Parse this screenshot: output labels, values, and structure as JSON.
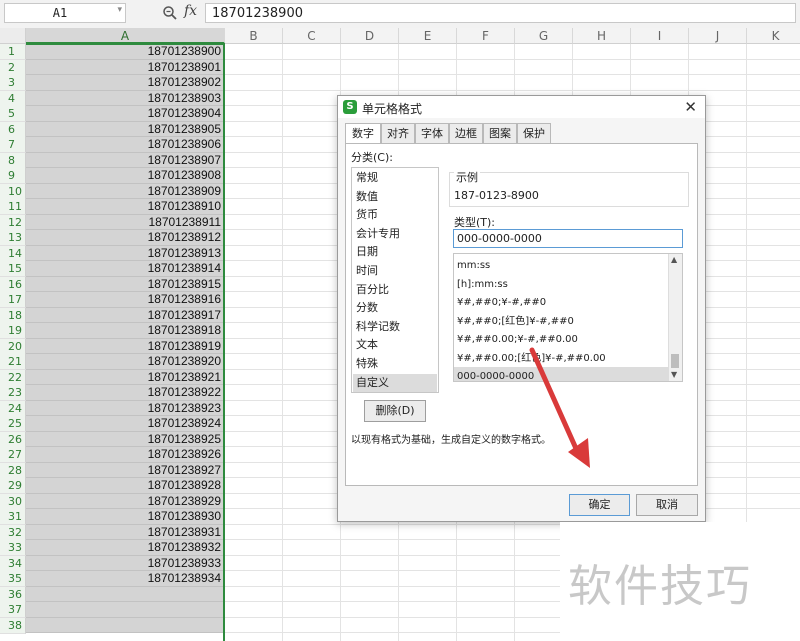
{
  "formula_bar": {
    "name_box": "A1",
    "fx_label": "fx",
    "formula": "18701238900"
  },
  "columns": [
    "A",
    "B",
    "C",
    "D",
    "E",
    "F",
    "G",
    "H",
    "I",
    "J",
    "K"
  ],
  "rows": [
    "1",
    "2",
    "3",
    "4",
    "5",
    "6",
    "7",
    "8",
    "9",
    "10",
    "11",
    "12",
    "13",
    "14",
    "15",
    "16",
    "17",
    "18",
    "19",
    "20",
    "21",
    "22",
    "23",
    "24",
    "25",
    "26",
    "27",
    "28",
    "29",
    "30",
    "31",
    "32",
    "33",
    "34",
    "35",
    "36",
    "37",
    "38"
  ],
  "column_a_values": [
    "18701238900",
    "18701238901",
    "18701238902",
    "18701238903",
    "18701238904",
    "18701238905",
    "18701238906",
    "18701238907",
    "18701238908",
    "18701238909",
    "18701238910",
    "18701238911",
    "18701238912",
    "18701238913",
    "18701238914",
    "18701238915",
    "18701238916",
    "18701238917",
    "18701238918",
    "18701238919",
    "18701238920",
    "18701238921",
    "18701238922",
    "18701238923",
    "18701238924",
    "18701238925",
    "18701238926",
    "18701238927",
    "18701238928",
    "18701238929",
    "18701238930",
    "18701238931",
    "18701238932",
    "18701238933",
    "18701238934",
    "",
    "",
    " "
  ],
  "dialog": {
    "icon_letter": "S",
    "title": "单元格格式",
    "close": "✕",
    "tabs": [
      "数字",
      "对齐",
      "字体",
      "边框",
      "图案",
      "保护"
    ],
    "active_tab": "数字",
    "category_label": "分类(C):",
    "categories": [
      "常规",
      "数值",
      "货币",
      "会计专用",
      "日期",
      "时间",
      "百分比",
      "分数",
      "科学记数",
      "文本",
      "特殊",
      "自定义"
    ],
    "selected_category": "自定义",
    "delete_button": "删除(D)",
    "sample_label": "示例",
    "sample_value": "187-0123-8900",
    "type_label": "类型(T):",
    "type_value": "000-0000-0000",
    "formats": [
      "mm:ss",
      "[h]:mm:ss",
      "¥#,##0;¥-#,##0",
      "¥#,##0;[红色]¥-#,##0",
      "¥#,##0.00;¥-#,##0.00",
      "¥#,##0.00;[红色]¥-#,##0.00",
      "000-0000-0000"
    ],
    "selected_format": "000-0000-0000",
    "description": "以现有格式为基础，生成自定义的数字格式。",
    "ok_button": "确定",
    "cancel_button": "取消"
  },
  "annotation": {
    "arrow_color": "#d93a3a"
  },
  "watermark": "软件技巧",
  "colors": {
    "selection_green": "#2e8b3e",
    "column_fill": "#d4d4d4",
    "focus_blue": "#5b9bd5"
  }
}
